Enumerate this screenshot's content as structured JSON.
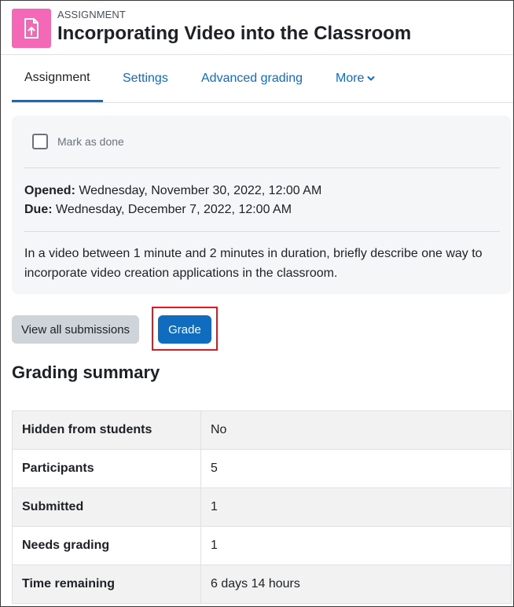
{
  "header": {
    "activity_type": "ASSIGNMENT",
    "title": "Incorporating Video into the Classroom",
    "icon": "assignment-upload-icon",
    "icon_color": "#f368b7"
  },
  "tabs": [
    {
      "label": "Assignment",
      "active": true
    },
    {
      "label": "Settings",
      "active": false
    },
    {
      "label": "Advanced grading",
      "active": false
    },
    {
      "label": "More",
      "active": false
    }
  ],
  "info": {
    "mark_as_done": "Mark as done",
    "opened_label": "Opened:",
    "opened_value": " Wednesday, November 30, 2022, 12:00 AM",
    "due_label": "Due:",
    "due_value": " Wednesday, December 7, 2022, 12:00 AM",
    "description": "In a video between 1 minute and 2 minutes in duration, briefly describe one way to incorporate video creation applications in the classroom."
  },
  "actions": {
    "view_all_submissions": "View all submissions",
    "grade": "Grade"
  },
  "grading_summary": {
    "title": "Grading summary",
    "rows": [
      {
        "key": "Hidden from students",
        "value": "No"
      },
      {
        "key": "Participants",
        "value": "5"
      },
      {
        "key": "Submitted",
        "value": "1"
      },
      {
        "key": "Needs grading",
        "value": "1"
      },
      {
        "key": "Time remaining",
        "value": "6 days 14 hours"
      }
    ]
  },
  "colors": {
    "primary": "#0f6cbf",
    "highlight": "#e0191f"
  }
}
